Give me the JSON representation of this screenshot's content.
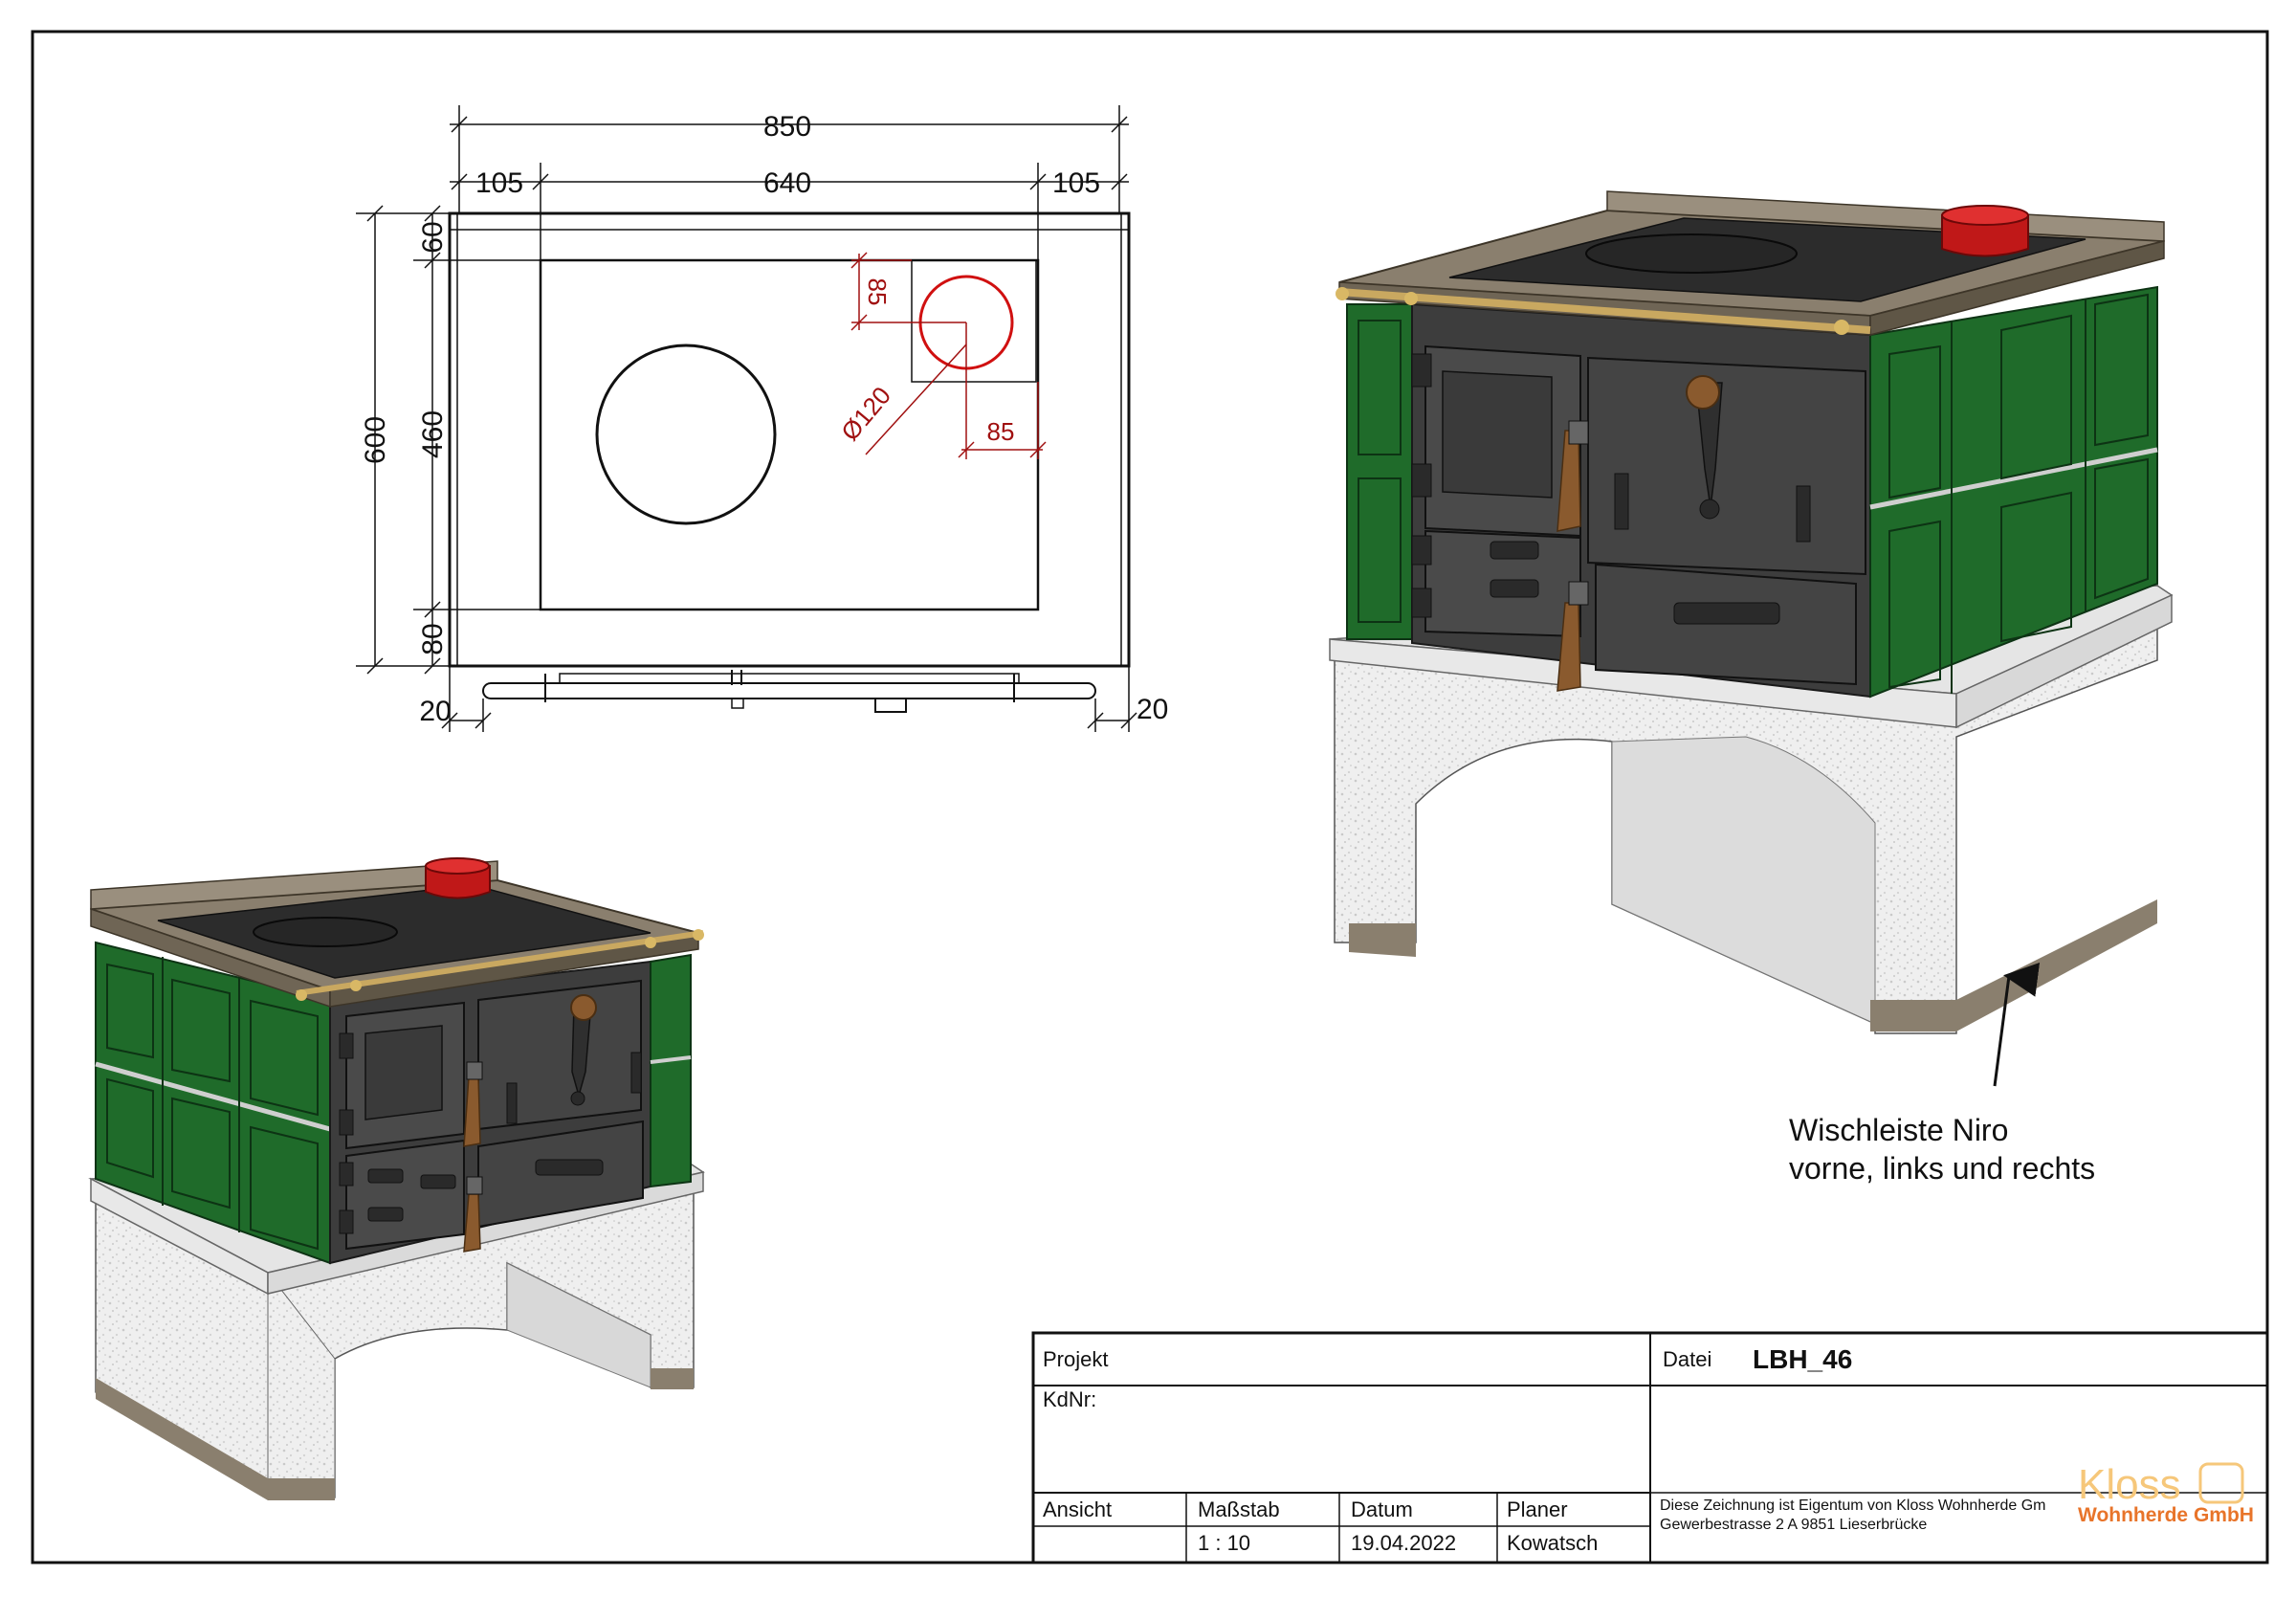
{
  "dimensions": {
    "total_width": "850",
    "left_margin": "105",
    "center_width": "640",
    "right_margin": "105",
    "total_depth": "600",
    "inner_depth": "460",
    "top_margin": "60",
    "bottom_margin": "80",
    "rail_left": "20",
    "rail_right": "20",
    "flue_offset_top": "85",
    "flue_offset_side": "85",
    "flue_diameter": "Ø120"
  },
  "annotation": {
    "line1": "Wischleiste Niro",
    "line2": "vorne, links und rechts"
  },
  "title_block": {
    "projekt_label": "Projekt",
    "datei_label": "Datei",
    "datei_value": "LBH_46",
    "kdnr_label": "KdNr:",
    "ansicht_label": "Ansicht",
    "massstab_label": "Maßstab",
    "massstab_value": "1 : 10",
    "datum_label": "Datum",
    "datum_value": "19.04.2022",
    "planer_label": "Planer",
    "planer_value": "Kowatsch",
    "ownership_line1": "Diese Zeichnung ist Eigentum von Kloss Wohnherde Gm",
    "ownership_line2": "Gewerbestrasse 2 A 9851 Lieserbrücke"
  },
  "logo": {
    "brand": "Kloss",
    "tagline": "Wohnherde GmbH"
  },
  "colors": {
    "tile_green": "#1f6b2a",
    "cast_iron": "#3d3d3d",
    "top_plate": "#8a7f6e",
    "plaster": "#eeeeee",
    "flue_red": "#c01818",
    "dim_red": "#a01010"
  }
}
